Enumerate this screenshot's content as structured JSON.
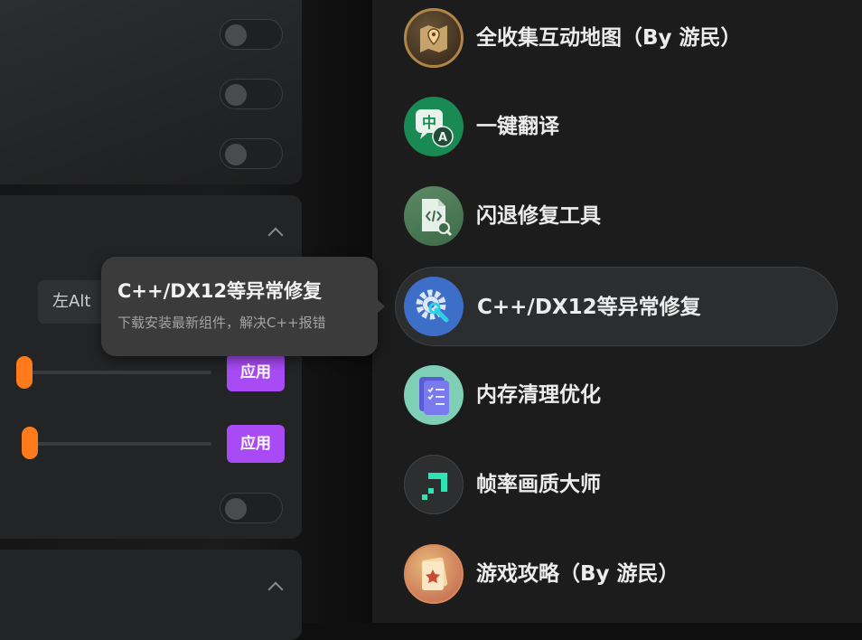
{
  "settings": {
    "key_label": "左Alt",
    "apply_label_1": "应用",
    "apply_label_2": "应用"
  },
  "tooltip": {
    "title": "C++/DX12等异常修复",
    "subtitle": "下载安装最新组件，解决C++报错"
  },
  "menu": {
    "items": [
      {
        "label": "全收集互动地图（By 游民）",
        "icon": "map-icon"
      },
      {
        "label": "一键翻译",
        "icon": "translate-icon"
      },
      {
        "label": "闪退修复工具",
        "icon": "code-fix-icon"
      },
      {
        "label": "C++/DX12等异常修复",
        "icon": "gear-wrench-icon",
        "active": true
      },
      {
        "label": "内存清理优化",
        "icon": "memory-checklist-icon"
      },
      {
        "label": "帧率画质大师",
        "icon": "fps-icon"
      },
      {
        "label": "游戏攻略（By 游民）",
        "icon": "guide-card-icon"
      }
    ]
  },
  "colors": {
    "accent_orange": "#ff7a1a",
    "accent_purple": "#a94bf5"
  }
}
